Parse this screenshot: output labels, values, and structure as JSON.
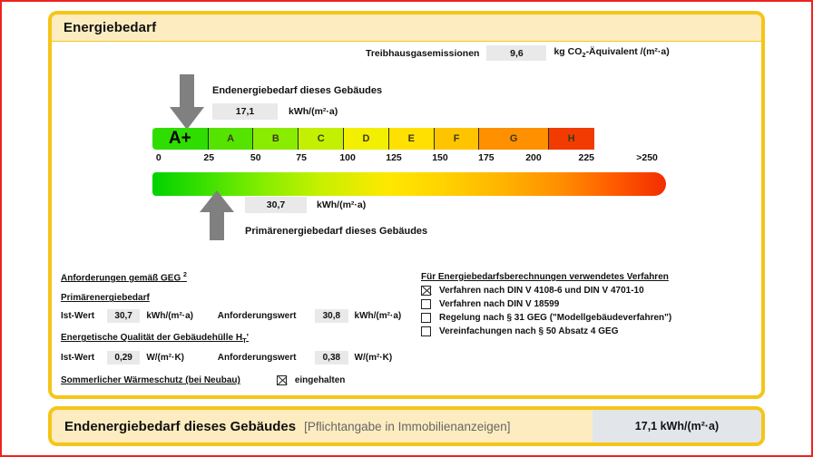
{
  "card": {
    "header_title": "Energiebedarf"
  },
  "ghg": {
    "label": "Treibhausgasemissionen",
    "value": "9,6",
    "unit_pre": "kg CO",
    "unit_sub": "2",
    "unit_post": "-Äquivalent /(m²·a)"
  },
  "end_energy": {
    "label": "Endenergiebedarf dieses Gebäudes",
    "value": "17,1",
    "unit": "kWh/(m²·a)"
  },
  "primary_energy": {
    "label": "Primärenergiebedarf dieses Gebäudes",
    "value": "30,7",
    "unit": "kWh/(m²·a)"
  },
  "scale": {
    "classes": [
      {
        "label": "A+",
        "color": "#2fdd00",
        "width": 10.9
      },
      {
        "label": "A",
        "color": "#55e300",
        "width": 8.8
      },
      {
        "label": "B",
        "color": "#8aec00",
        "width": 8.8
      },
      {
        "label": "C",
        "color": "#c2f000",
        "width": 8.8
      },
      {
        "label": "D",
        "color": "#f3ef00",
        "width": 8.8
      },
      {
        "label": "E",
        "color": "#ffe000",
        "width": 8.8
      },
      {
        "label": "F",
        "color": "#ffc400",
        "width": 8.8
      },
      {
        "label": "G",
        "color": "#ff9000",
        "width": 13.5
      },
      {
        "label": "H",
        "color": "#f23b00",
        "width": 8.8
      }
    ],
    "ticks": [
      {
        "label": "0",
        "pos": 1.2
      },
      {
        "label": "25",
        "pos": 11.0
      },
      {
        "label": "50",
        "pos": 20.1
      },
      {
        "label": "75",
        "pos": 29.0
      },
      {
        "label": "100",
        "pos": 38.0
      },
      {
        "label": "125",
        "pos": 47.0
      },
      {
        "label": "150",
        "pos": 56.0
      },
      {
        "label": "175",
        "pos": 65.0
      },
      {
        "label": "200",
        "pos": 74.2
      },
      {
        "label": "225",
        "pos": 84.5
      },
      {
        "label": ">250",
        "pos": 96.3
      }
    ]
  },
  "requirements": {
    "heading": "Anforderungen gemäß GEG",
    "heading_sup": "2",
    "primary": {
      "sub_heading": "Primärenergiebedarf",
      "actual_label": "Ist-Wert",
      "actual_value": "30,7",
      "actual_unit": "kWh/(m²·a)",
      "required_label": "Anforderungswert",
      "required_value": "30,8",
      "required_unit": "kWh/(m²·a)"
    },
    "envelope": {
      "sub_heading_pre": "Energetische Qualität der Gebäudehülle H",
      "sub_heading_sub": "T",
      "sub_heading_post": "'",
      "actual_label": "Ist-Wert",
      "actual_value": "0,29",
      "actual_unit": "W/(m²·K)",
      "required_label": "Anforderungswert",
      "required_value": "0,38",
      "required_unit": "W/(m²·K)"
    },
    "summer": {
      "label": "Sommerlicher Wärmeschutz (bei Neubau)",
      "checkbox_name": "summer-protection-checkbox",
      "checked": true,
      "check_label": "eingehalten"
    }
  },
  "methods": {
    "heading": "Für Energiebedarfsberechnungen verwendetes Verfahren",
    "options": [
      {
        "label": "Verfahren nach DIN V 4108-6 und DIN V 4701-10",
        "checked": true
      },
      {
        "label": "Verfahren nach DIN V 18599",
        "checked": false
      },
      {
        "label": "Regelung nach § 31 GEG (\"Modellgebäudeverfahren\")",
        "checked": false
      },
      {
        "label": "Vereinfachungen nach § 50 Absatz 4 GEG",
        "checked": false
      }
    ]
  },
  "bottom_bar": {
    "title": "Endenergiebedarf dieses Gebäudes",
    "note": "[Pflichtangabe in Immobilienanzeigen]",
    "value": "17,1 kWh/(m²·a)"
  },
  "colors": {
    "frame_red": "#ee2222",
    "frame_yellow": "#f5c518",
    "header_bg": "#fdecbf",
    "value_box_bg": "#e9e9e9",
    "arrow_gray": "#808080"
  }
}
